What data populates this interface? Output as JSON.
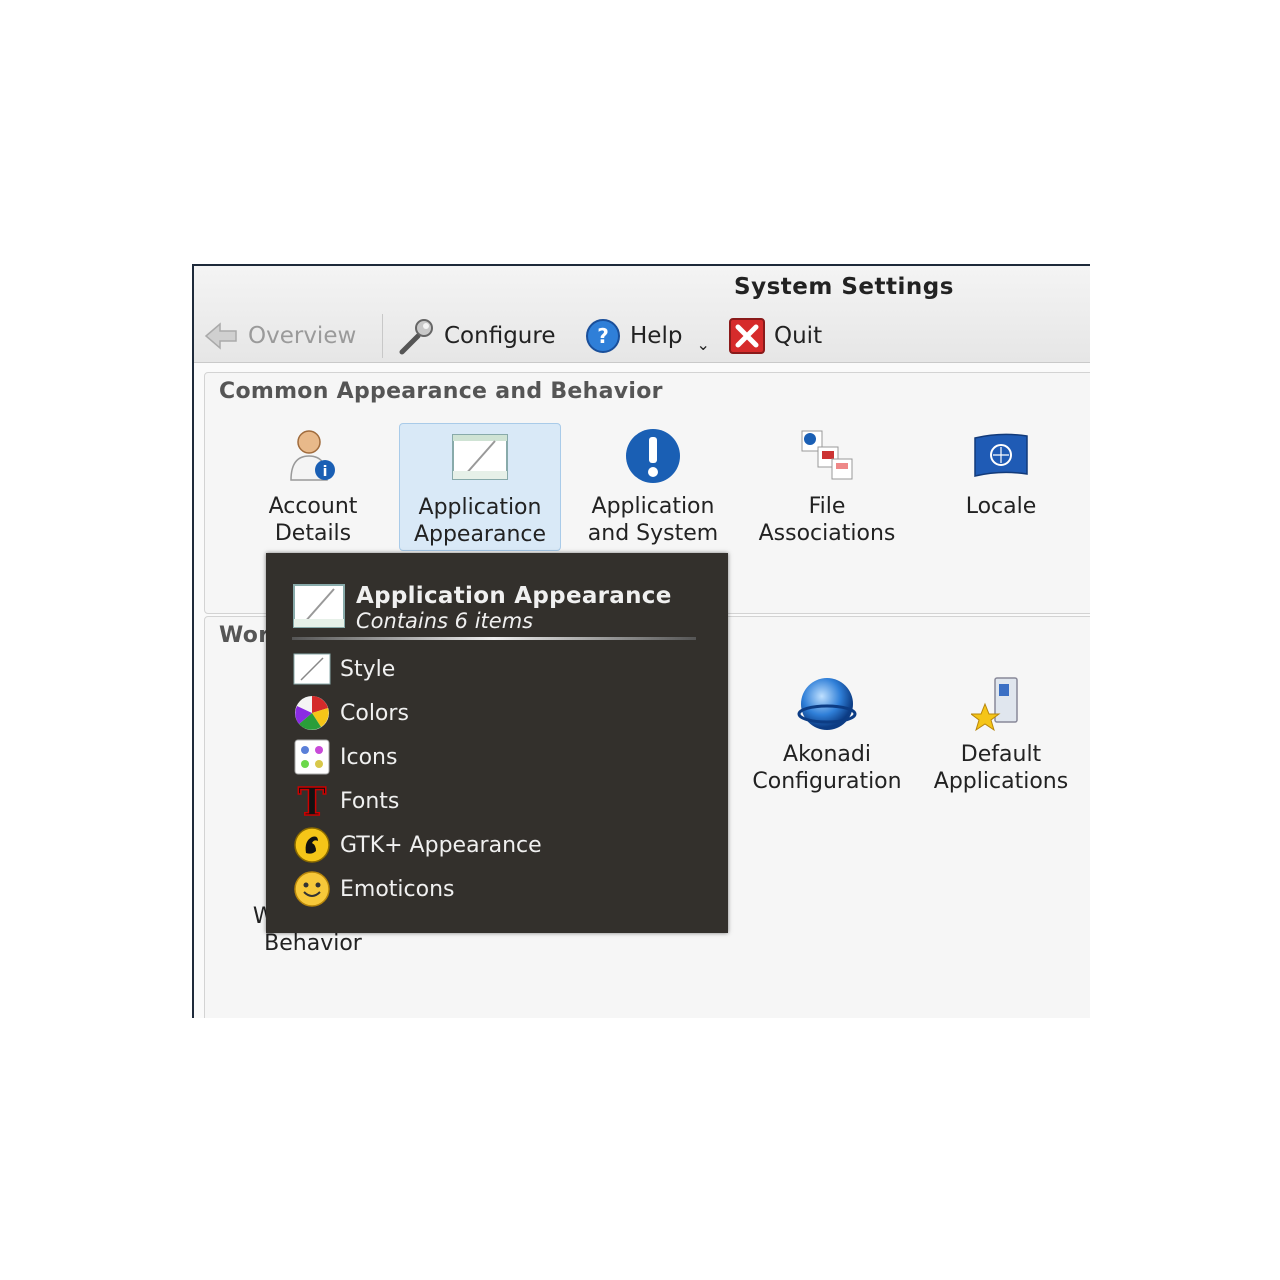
{
  "window": {
    "title": "System Settings"
  },
  "toolbar": {
    "overview_label": "Overview",
    "configure_label": "Configure",
    "help_label": "Help",
    "quit_label": "Quit"
  },
  "groups": [
    {
      "title": "Common Appearance and Behavior",
      "items": [
        {
          "label": "Account Details",
          "icon": "user-info-icon"
        },
        {
          "label": "Application Appearance",
          "icon": "window-style-icon",
          "selected": true
        },
        {
          "label": "Application and System Notifications",
          "icon": "notification-exclamation-icon"
        },
        {
          "label": "File Associations",
          "icon": "file-associations-icon"
        },
        {
          "label": "Locale",
          "icon": "un-flag-icon"
        }
      ]
    },
    {
      "title": "Workspace Behavior",
      "items": [
        {
          "label": "Workspace Behavior",
          "icon": "workspace-icon"
        },
        {
          "label": "Akonadi Configuration",
          "icon": "akonadi-sphere-icon"
        },
        {
          "label": "Default Applications",
          "icon": "default-apps-icon"
        }
      ]
    }
  ],
  "tooltip": {
    "title": "Application Appearance",
    "subtitle": "Contains 6 items",
    "items": [
      {
        "label": "Style",
        "icon": "style-icon"
      },
      {
        "label": "Colors",
        "icon": "colors-icon"
      },
      {
        "label": "Icons",
        "icon": "icons-icon"
      },
      {
        "label": "Fonts",
        "icon": "fonts-icon"
      },
      {
        "label": "GTK+ Appearance",
        "icon": "gtk-icon"
      },
      {
        "label": "Emoticons",
        "icon": "emoticons-icon"
      }
    ]
  },
  "colors": {
    "tooltip_bg": "#33302c",
    "selection": "#d9e9f7",
    "accent_blue": "#1a5fb4"
  }
}
